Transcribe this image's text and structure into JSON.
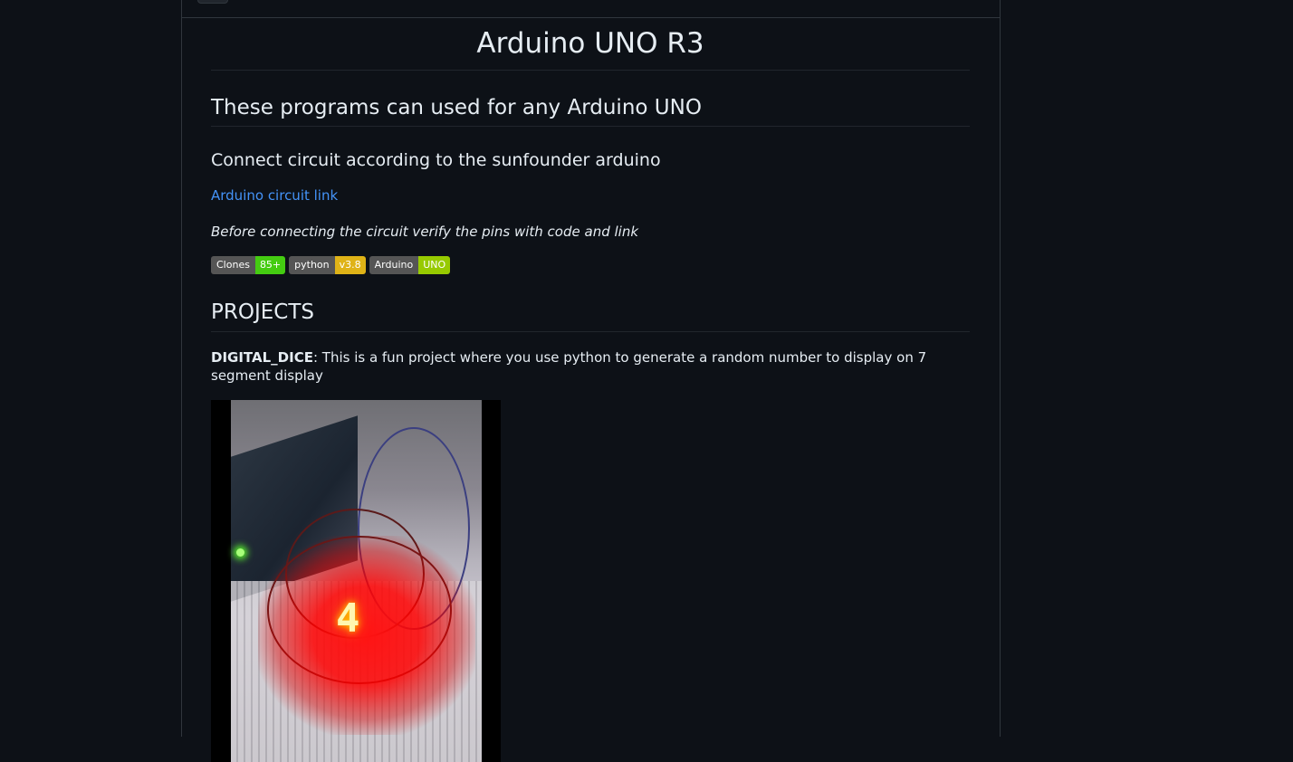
{
  "page": {
    "title": "Arduino UNO R3",
    "subtitle": "These programs can used for any Arduino UNO",
    "connect_heading": "Connect circuit according to the sunfounder arduino",
    "circuit_link": "Arduino circuit link",
    "note": "Before connecting the circuit verify the pins with code and link",
    "badges": [
      {
        "label": "Clones",
        "value": "85+",
        "color": "#4c1"
      },
      {
        "label": "python",
        "value": "v3.8",
        "color": "#dfb317"
      },
      {
        "label": "Arduino",
        "value": "UNO",
        "color": "#97ca00"
      }
    ],
    "projects_heading": "PROJECTS",
    "project": {
      "name": "DIGITAL_DICE",
      "description": ": This is a fun project where you use python to generate a random number to display on 7 segment display"
    },
    "photo": {
      "digit": "4"
    }
  }
}
